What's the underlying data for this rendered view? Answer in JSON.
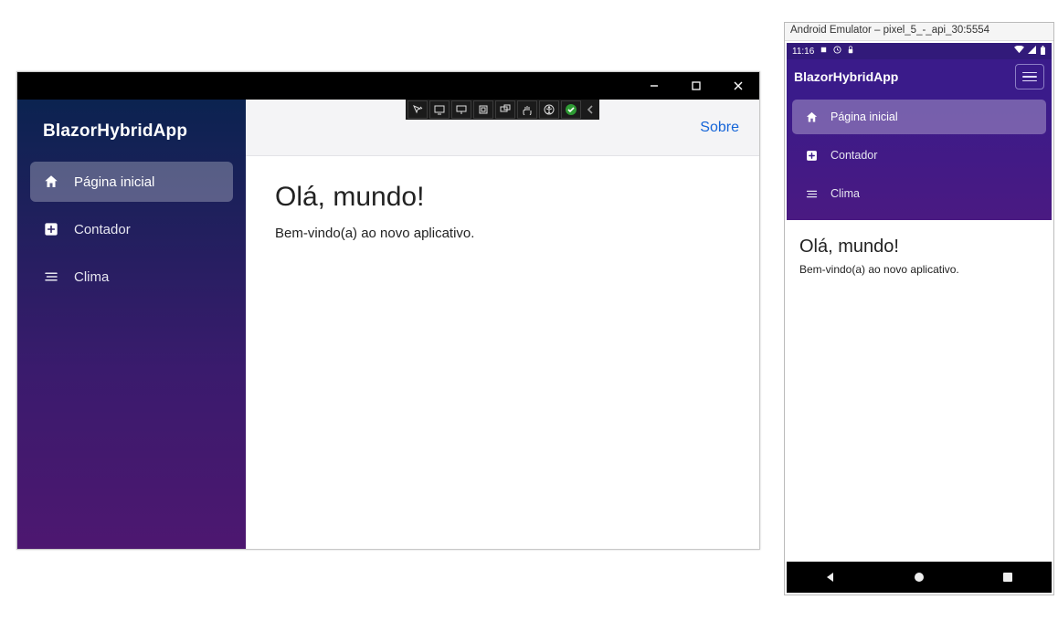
{
  "desktop": {
    "brand": "BlazorHybridApp",
    "nav": {
      "home": "Página inicial",
      "counter": "Contador",
      "weather": "Clima"
    },
    "about": "Sobre",
    "page": {
      "heading": "Olá, mundo!",
      "subtext": "Bem-vindo(a) ao novo aplicativo."
    }
  },
  "emulator": {
    "title": "Android Emulator – pixel_5_-_api_30:5554",
    "status_time": "11:16",
    "brand": "BlazorHybridApp",
    "nav": {
      "home": "Página inicial",
      "counter": "Contador",
      "weather": "Clima"
    },
    "page": {
      "heading": "Olá, mundo!",
      "subtext": "Bem-vindo(a) ao novo aplicativo."
    }
  }
}
